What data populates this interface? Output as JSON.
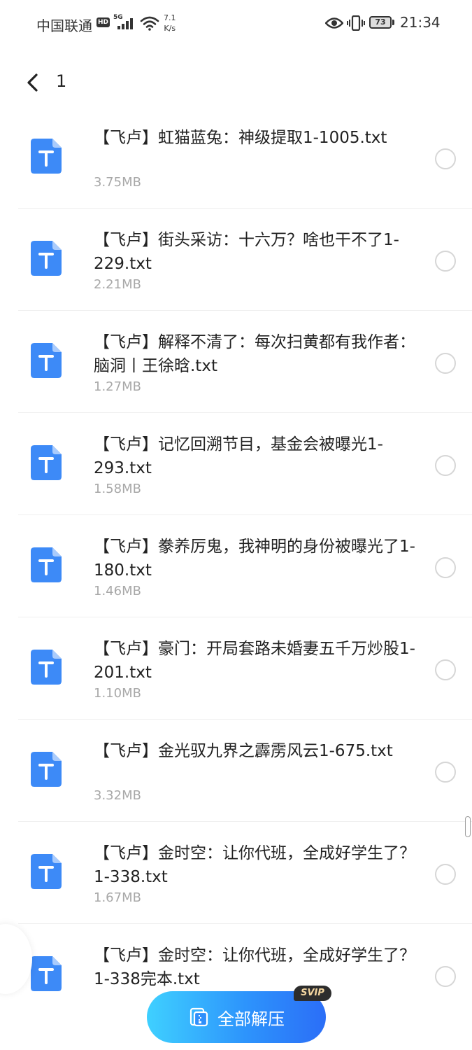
{
  "status_bar": {
    "carrier": "中国联通",
    "hd": "HD",
    "network": "5G",
    "speed_value": "7.1",
    "speed_unit": "K/s",
    "battery": "73",
    "time": "21:34"
  },
  "header": {
    "title": "1"
  },
  "files": [
    {
      "name": "【飞卢】虹猫蓝兔：神级提取1-1005.txt",
      "size": "3.75MB"
    },
    {
      "name": "【飞卢】街头采访：十六万？啥也干不了1-229.txt",
      "size": "2.21MB"
    },
    {
      "name": "【飞卢】解释不清了：每次扫黄都有我作者：脑洞丨王徐晗.txt",
      "size": "1.27MB"
    },
    {
      "name": "【飞卢】记忆回溯节目，基金会被曝光1-293.txt",
      "size": "1.58MB"
    },
    {
      "name": "【飞卢】豢养厉鬼，我神明的身份被曝光了1-180.txt",
      "size": "1.46MB"
    },
    {
      "name": "【飞卢】豪门：开局套路未婚妻五千万炒股1-201.txt",
      "size": "1.10MB"
    },
    {
      "name": "【飞卢】金光驭九界之霹雳风云1-675.txt",
      "size": "3.32MB"
    },
    {
      "name": "【飞卢】金时空：让你代班，全成好学生了？1-338.txt",
      "size": "1.67MB"
    },
    {
      "name": "【飞卢】金时空：让你代班，全成好学生了？1-338完本.txt",
      "size": ""
    }
  ],
  "extract_button": {
    "label": "全部解压",
    "badge": "SVIP"
  },
  "colors": {
    "accent": "#2d94fc",
    "file_icon": "#3d8af7",
    "muted_text": "#a8a8a8"
  },
  "icons": {
    "back": "chevron-left-icon",
    "file": "text-file-icon",
    "extract": "unzip-icon"
  }
}
